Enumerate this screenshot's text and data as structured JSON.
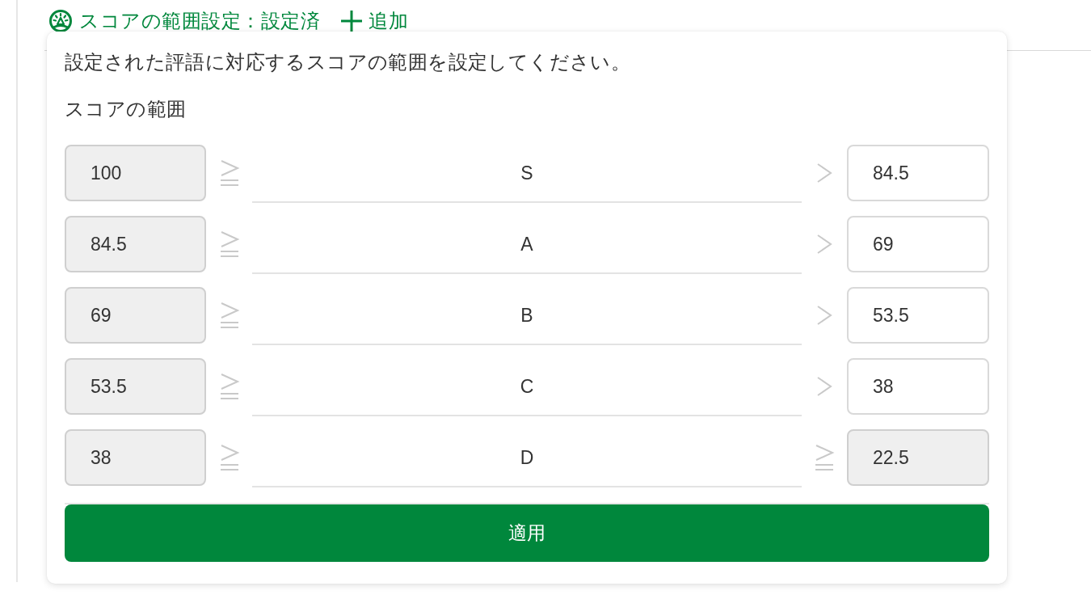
{
  "header": {
    "status_label": "スコアの範囲設定：設定済",
    "add_button": "追加"
  },
  "popover": {
    "description": "設定された評語に対応するスコアの範囲を設定してください。",
    "section_label": "スコアの範囲",
    "ranges": [
      {
        "upper": {
          "value": "100",
          "disabled": true
        },
        "upper_inclusive": true,
        "grade": "S",
        "lower_inclusive": false,
        "lower": {
          "value": "84.5",
          "disabled": false
        }
      },
      {
        "upper": {
          "value": "84.5",
          "disabled": true
        },
        "upper_inclusive": true,
        "grade": "A",
        "lower_inclusive": false,
        "lower": {
          "value": "69",
          "disabled": false
        }
      },
      {
        "upper": {
          "value": "69",
          "disabled": true
        },
        "upper_inclusive": true,
        "grade": "B",
        "lower_inclusive": false,
        "lower": {
          "value": "53.5",
          "disabled": false
        }
      },
      {
        "upper": {
          "value": "53.5",
          "disabled": true
        },
        "upper_inclusive": true,
        "grade": "C",
        "lower_inclusive": false,
        "lower": {
          "value": "38",
          "disabled": false
        }
      },
      {
        "upper": {
          "value": "38",
          "disabled": true
        },
        "upper_inclusive": true,
        "grade": "D",
        "lower_inclusive": true,
        "lower": {
          "value": "22.5",
          "disabled": true
        }
      }
    ],
    "apply_button": "適用"
  }
}
